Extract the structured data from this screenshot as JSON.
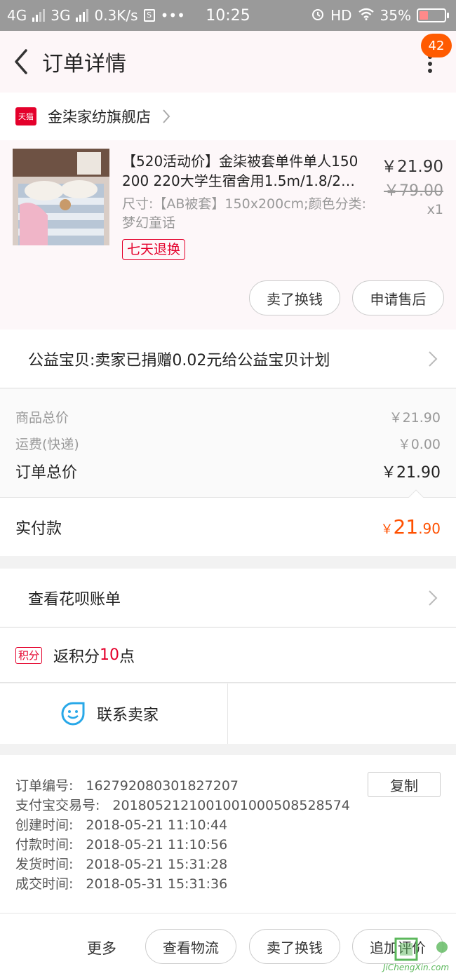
{
  "status_bar": {
    "network1": "4G",
    "network2": "3G",
    "speed": "0.3K/s",
    "dots": "•••",
    "time": "10:25",
    "hd": "HD",
    "battery": "35%",
    "battery_level": 0.35
  },
  "header": {
    "title": "订单详情",
    "badge_count": "42"
  },
  "shop": {
    "badge": "天猫",
    "name": "金柒家纺旗舰店"
  },
  "item": {
    "title": "【520活动价】金柒被套单件单人150 200 220大学生宿舍用1.5m/1.8/2…",
    "sku": "尺寸:【AB被套】150x200cm;颜色分类:梦幻童话",
    "tag": "七天退换",
    "price": "￥21.90",
    "original_price": "￥79.00",
    "qty": "x1",
    "btn_sell": "卖了换钱",
    "btn_aftersale": "申请售后"
  },
  "charity": {
    "text": "公益宝贝:卖家已捐赠0.02元给公益宝贝计划"
  },
  "summary": {
    "goods_label": "商品总价",
    "goods_value": "￥21.90",
    "ship_label": "运费(快递)",
    "ship_value": "￥0.00",
    "total_label": "订单总价",
    "total_value": "￥21.90"
  },
  "paid": {
    "label": "实付款",
    "currency": "￥",
    "int": "21",
    "dec": ".90"
  },
  "huabei": {
    "text": "查看花呗账单"
  },
  "points": {
    "tag": "积分",
    "prefix": "返积分",
    "num": "10",
    "suffix": "点"
  },
  "contact": {
    "text": "联系卖家"
  },
  "info": {
    "order_no_label": "订单编号:",
    "order_no": "162792080301827207",
    "copy": "复制",
    "alipay_label": "支付宝交易号:",
    "alipay_no": "2018052121001001000508528574",
    "created_label": "创建时间:",
    "created": "2018-05-21 11:10:44",
    "paid_label": "付款时间:",
    "paid": "2018-05-21 11:10:56",
    "shipped_label": "发货时间:",
    "shipped": "2018-05-21 15:31:28",
    "closed_label": "成交时间:",
    "closed": "2018-05-31 15:31:36"
  },
  "footer": {
    "more": "更多",
    "logistics": "查看物流",
    "sell": "卖了换钱",
    "review": "追加评价"
  },
  "watermark": {
    "text": "JiChengXin.com"
  }
}
